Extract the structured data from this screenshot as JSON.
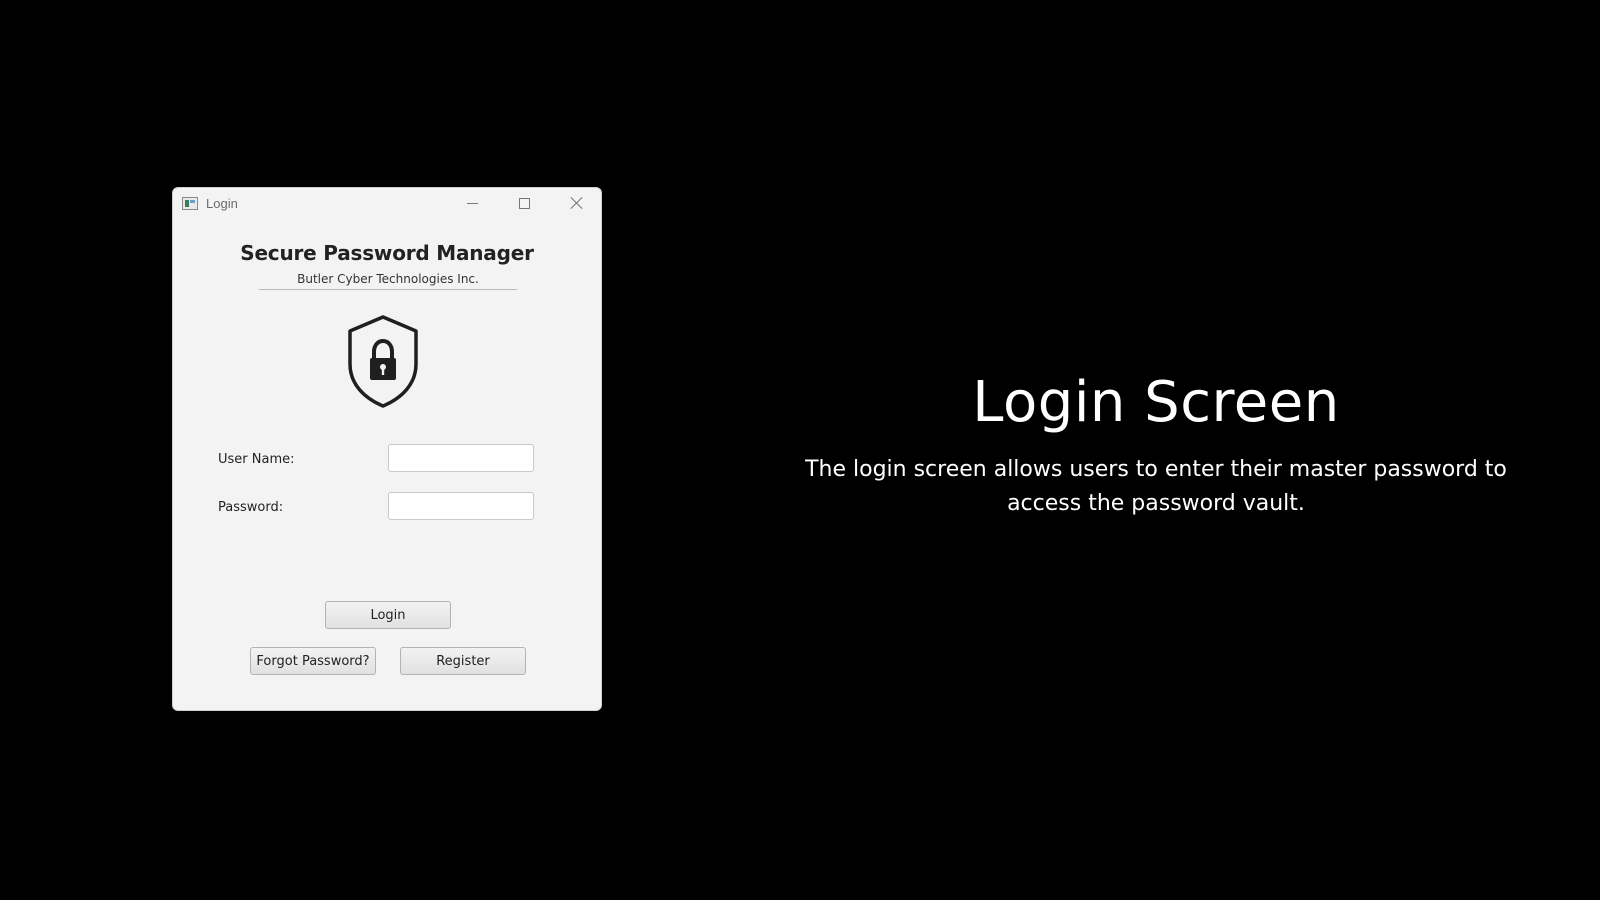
{
  "window": {
    "title": "Login",
    "controls": {
      "minimize_icon": "minimize-icon",
      "maximize_icon": "maximize-icon",
      "close_icon": "close-icon"
    }
  },
  "login_form": {
    "heading": "Secure Password Manager",
    "company": "Butler Cyber Technologies Inc.",
    "logo_icon": "shield-lock-icon",
    "username_label": "User Name:",
    "username_value": "",
    "password_label": "Password:",
    "password_value": "",
    "login_button": "Login",
    "forgot_button": "Forgot Password?",
    "register_button": "Register"
  },
  "caption": {
    "title": "Login Screen",
    "description": "The login screen allows users to enter their master password to access the password vault."
  },
  "colors": {
    "background": "#000000",
    "window_background": "#f3f3f3",
    "caption_text": "#ffffff"
  }
}
